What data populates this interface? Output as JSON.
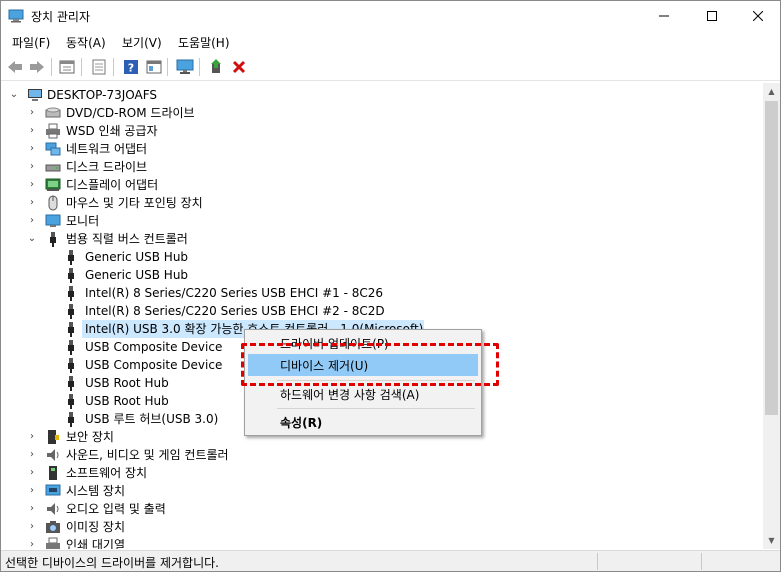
{
  "window": {
    "title": "장치 관리자",
    "controls": [
      "minimize",
      "maximize",
      "close"
    ]
  },
  "menu": [
    "파일(F)",
    "동작(A)",
    "보기(V)",
    "도움말(H)"
  ],
  "toolbar": {
    "icons": [
      "back-icon",
      "forward-icon",
      "properties-pane-icon",
      "list-icon",
      "help-icon",
      "view-icon",
      "monitor-icon",
      "update-driver-icon",
      "remove-device-icon"
    ]
  },
  "tree": {
    "root": "DESKTOP-73JOAFS",
    "categories": [
      "DVD/CD-ROM 드라이브",
      "WSD 인쇄 공급자",
      "네트워크 어댑터",
      "디스크 드라이브",
      "디스플레이 어댑터",
      "마우스 및 기타 포인팅 장치",
      "모니터",
      "범용 직렬 버스 컨트롤러"
    ],
    "usb_children": [
      "Generic USB Hub",
      "Generic USB Hub",
      "Intel(R) 8 Series/C220 Series USB EHCI #1 - 8C26",
      "Intel(R) 8 Series/C220 Series USB EHCI #2 - 8C2D",
      "Intel(R) USB 3.0 확장 가능한 호스트 컨트롤러 - 1.0(Microsoft)",
      "USB Composite Device",
      "USB Composite Device",
      "USB Root Hub",
      "USB Root Hub",
      "USB 루트 허브(USB 3.0)"
    ],
    "after_categories": [
      "보안 장치",
      "사운드, 비디오 및 게임 컨트롤러",
      "소프트웨어 장치",
      "시스템 장치",
      "오디오 입력 및 출력",
      "이미징 장치",
      "인쇄 대기열"
    ]
  },
  "context_menu": {
    "items": [
      "드라이버 업데이트(P)",
      "디바이스 제거(U)",
      "하드웨어 변경 사항 검색(A)",
      "속성(R)"
    ],
    "highlighted_index": 1
  },
  "status": "선택한 디바이스의 드라이버를 제거합니다.",
  "colors": {
    "selection": "#cce8ff",
    "menu_highlight": "#91c9f7",
    "annotation": "#e00000"
  }
}
